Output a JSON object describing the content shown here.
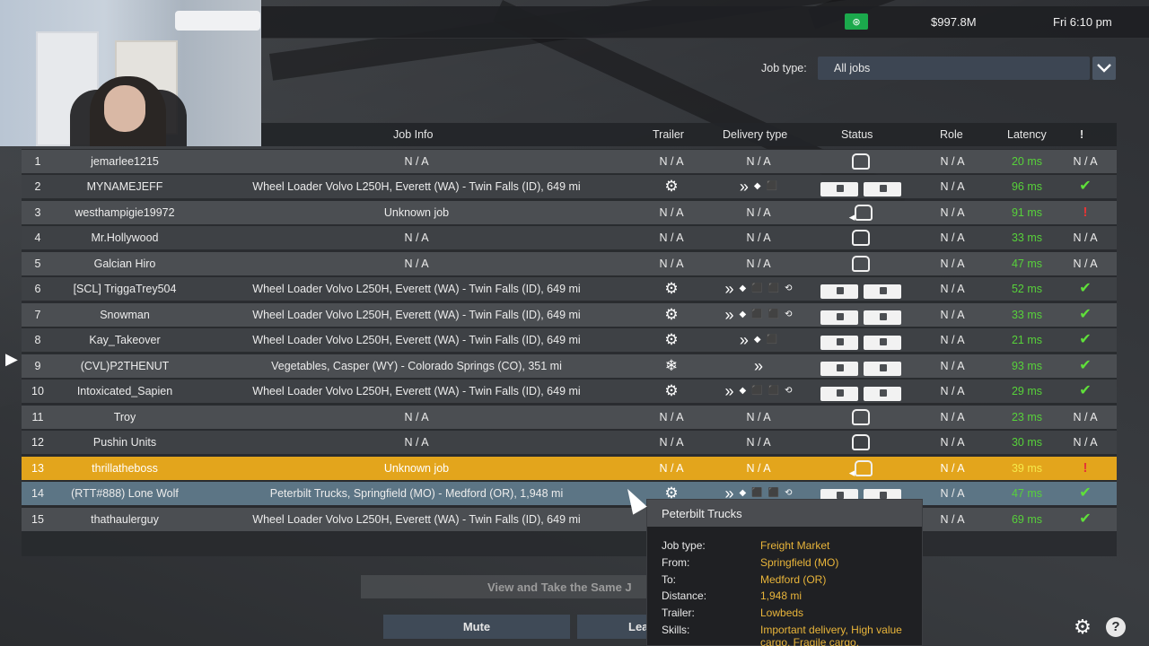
{
  "topbar": {
    "money_badge": "⊛",
    "money": "$997.8M",
    "clock": "Fri 6:10 pm"
  },
  "filter": {
    "label": "Job type:",
    "value": "All jobs"
  },
  "columns": {
    "job_info": "Job Info",
    "trailer": "Trailer",
    "delivery_type": "Delivery type",
    "status": "Status",
    "role": "Role",
    "latency": "Latency",
    "flag": "!"
  },
  "rows": [
    {
      "num": "1",
      "name": "jemarlee1215",
      "job": "N / A",
      "trailer": "N / A",
      "delivery": "N / A",
      "status": "car",
      "role": "N / A",
      "latency": "20 ms",
      "flag": "N / A"
    },
    {
      "num": "2",
      "name": "MYNAMEJEFF",
      "job": "Wheel Loader Volvo L250H, Everett (WA) - Twin Falls (ID), 649 mi",
      "trailer": "gear",
      "delivery": "icons3",
      "status": "trucks",
      "role": "N / A",
      "latency": "96 ms",
      "flag": "check"
    },
    {
      "num": "3",
      "name": "westhampigie19972",
      "job": "Unknown job",
      "trailer": "N / A",
      "delivery": "N / A",
      "status": "car-arrow",
      "role": "N / A",
      "latency": "91 ms",
      "flag": "excl"
    },
    {
      "num": "4",
      "name": "Mr.Hollywood",
      "job": "N / A",
      "trailer": "N / A",
      "delivery": "N / A",
      "status": "car",
      "role": "N / A",
      "latency": "33 ms",
      "flag": "N / A"
    },
    {
      "num": "5",
      "name": "Galcian Hiro",
      "job": "N / A",
      "trailer": "N / A",
      "delivery": "N / A",
      "status": "car",
      "role": "N / A",
      "latency": "47 ms",
      "flag": "N / A"
    },
    {
      "num": "6",
      "name": "[SCL] TriggaTrey504",
      "job": "Wheel Loader Volvo L250H, Everett (WA) - Twin Falls (ID), 649 mi",
      "trailer": "gear",
      "delivery": "icons5",
      "status": "trucks",
      "role": "N / A",
      "latency": "52 ms",
      "flag": "check"
    },
    {
      "num": "7",
      "name": "Snowman",
      "job": "Wheel Loader Volvo L250H, Everett (WA) - Twin Falls (ID), 649 mi",
      "trailer": "gear",
      "delivery": "icons5",
      "status": "trucks",
      "role": "N / A",
      "latency": "33 ms",
      "flag": "check"
    },
    {
      "num": "8",
      "name": "Kay_Takeover",
      "job": "Wheel Loader Volvo L250H, Everett (WA) - Twin Falls (ID), 649 mi",
      "trailer": "gear",
      "delivery": "icons3",
      "status": "trucks",
      "role": "N / A",
      "latency": "21 ms",
      "flag": "check"
    },
    {
      "num": "9",
      "name": "(CVL)P2THENUT",
      "job": "Vegetables, Casper (WY) - Colorado Springs (CO), 351 mi",
      "trailer": "snow",
      "delivery": "icons1",
      "status": "trucks",
      "role": "N / A",
      "latency": "93 ms",
      "flag": "check"
    },
    {
      "num": "10",
      "name": "Intoxicated_Sapien",
      "job": "Wheel Loader Volvo L250H, Everett (WA) - Twin Falls (ID), 649 mi",
      "trailer": "gear",
      "delivery": "icons5",
      "status": "trucks",
      "role": "N / A",
      "latency": "29 ms",
      "flag": "check"
    },
    {
      "num": "11",
      "name": "Troy",
      "job": "N / A",
      "trailer": "N / A",
      "delivery": "N / A",
      "status": "car",
      "role": "N / A",
      "latency": "23 ms",
      "flag": "N / A"
    },
    {
      "num": "12",
      "name": "Pushin Units",
      "job": "N / A",
      "trailer": "N / A",
      "delivery": "N / A",
      "status": "car",
      "role": "N / A",
      "latency": "30 ms",
      "flag": "N / A"
    },
    {
      "num": "13",
      "name": "thrillatheboss",
      "job": "Unknown job",
      "trailer": "N / A",
      "delivery": "N / A",
      "status": "car-arrow",
      "role": "N / A",
      "latency": "39 ms",
      "flag": "excl"
    },
    {
      "num": "14",
      "name": "(RTT#888) Lone Wolf",
      "job": "Peterbilt Trucks, Springfield (MO) - Medford (OR), 1,948 mi",
      "trailer": "gear",
      "delivery": "icons5",
      "status": "trucks",
      "role": "N / A",
      "latency": "47 ms",
      "flag": "check"
    },
    {
      "num": "15",
      "name": "thathaulerguy",
      "job": "Wheel Loader Volvo L250H, Everett (WA) - Twin Falls (ID), 649 mi",
      "trailer": "gear",
      "delivery": "icons5",
      "status": "trucks",
      "role": "N / A",
      "latency": "69 ms",
      "flag": "check"
    }
  ],
  "buttons": {
    "view_same": "View and Take the Same J",
    "mute": "Mute",
    "leave": "Lea"
  },
  "tooltip": {
    "title": "Peterbilt Trucks",
    "job_type_label": "Job type:",
    "job_type": "Freight Market",
    "from_label": "From:",
    "from": "Springfield (MO)",
    "to_label": "To:",
    "to": "Medford (OR)",
    "distance_label": "Distance:",
    "distance": "1,948 mi",
    "trailer_label": "Trailer:",
    "trailer": "Lowbeds",
    "skills_label": "Skills:",
    "skills": "Important delivery, High value cargo, Fragile cargo,"
  },
  "colors": {
    "highlight_row": "#e3a51c",
    "selected_row": "#5c7585",
    "latency_green": "#57d13a",
    "tooltip_value": "#e9b53a"
  }
}
